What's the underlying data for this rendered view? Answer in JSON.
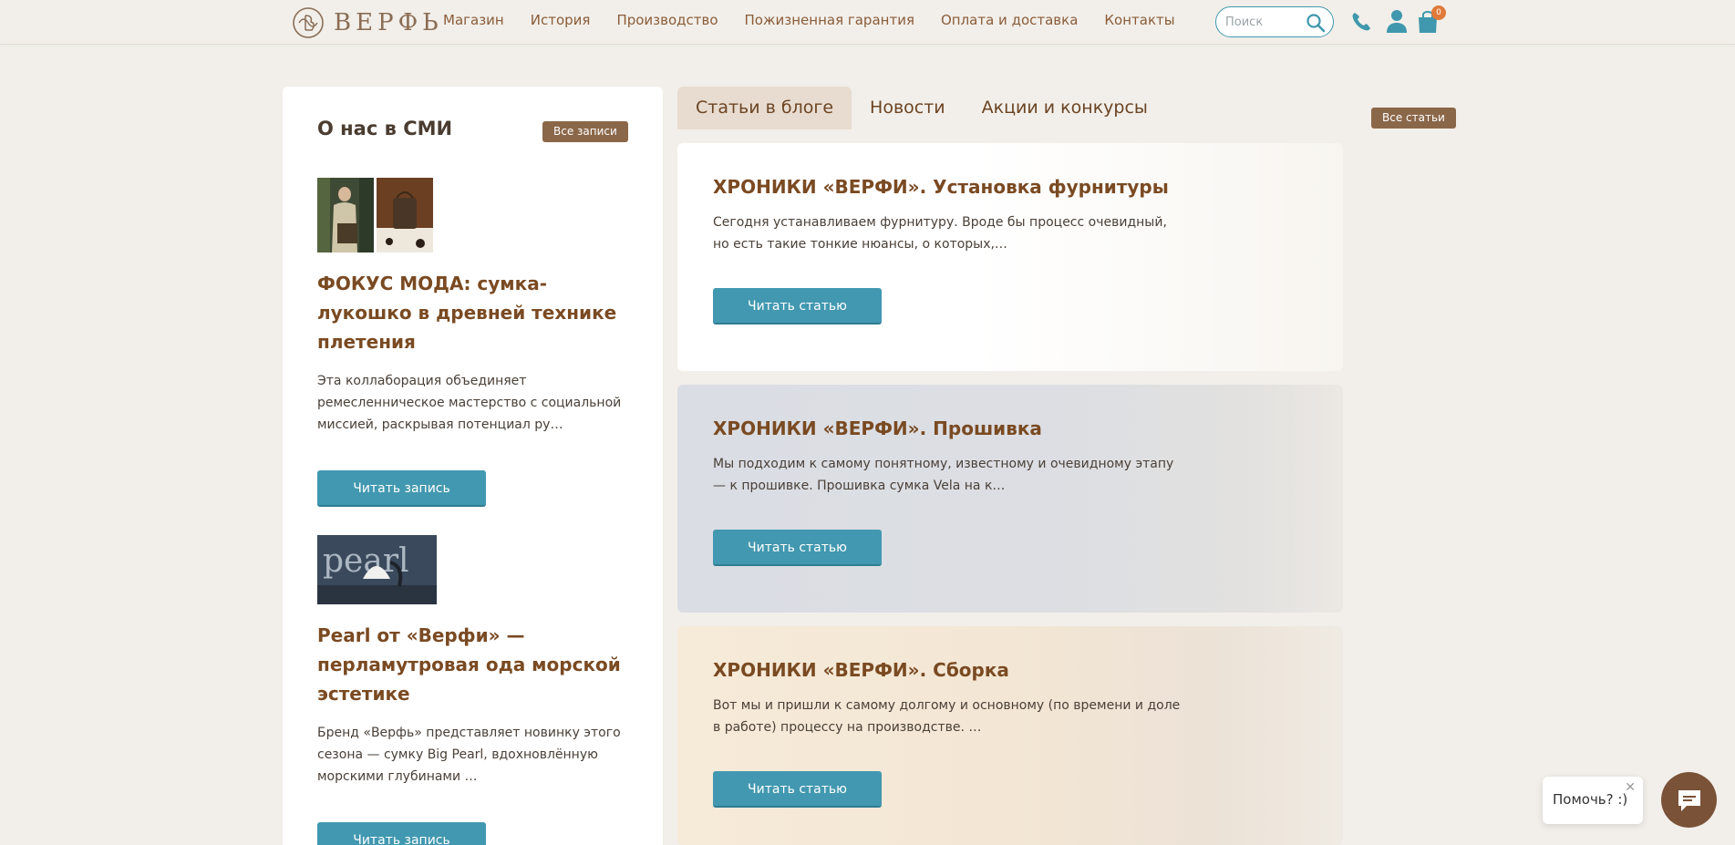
{
  "header": {
    "logo_text": "ВЕРФЬ",
    "nav": [
      "Магазин",
      "История",
      "Производство",
      "Пожизненная гарантия",
      "Оплата и доставка",
      "Контакты"
    ],
    "search_placeholder": "Поиск",
    "cart_count": "0"
  },
  "media": {
    "title": "О нас в СМИ",
    "all_label": "Все записи",
    "items": [
      {
        "title": "ФОКУС МОДА: сумка-лукошко в древней технике плетения",
        "text": "Эта коллаборация объединяет ремесленническое мастерство с социальной миссией, раскрывая потенциал ру…",
        "button": "Читать запись"
      },
      {
        "title": "Pearl от «Верфи» — перламутровая ода морской эстетике",
        "text": "Бренд «Верфь» представляет новинку этого сезона — сумку Big Pearl, вдохновлённую морскими глубинами …",
        "button": "Читать запись"
      }
    ]
  },
  "blog": {
    "tabs": [
      "Статьи в блоге",
      "Новости",
      "Акции и конкурсы"
    ],
    "all_label": "Все статьи",
    "articles": [
      {
        "title": "ХРОНИКИ «ВЕРФИ». Установка фурнитуры",
        "text": "Сегодня устанавливаем фурнитуру. Вроде бы процесс очевидный, но есть такие тонкие нюансы, о которых,…",
        "button": "Читать статью"
      },
      {
        "title": "ХРОНИКИ «ВЕРФИ». Прошивка",
        "text": "Мы подходим к самому понятному, известному и очевидному этапу — к прошивке. Прошивка сумка Vela на к…",
        "button": "Читать статью"
      },
      {
        "title": "ХРОНИКИ «ВЕРФИ». Сборка",
        "text": "Вот мы и пришли к самому долгому и основному (по времени и доле в работе) процессу на производстве. …",
        "button": "Читать статью"
      }
    ]
  },
  "widget": {
    "help_text": "Помочь? :)",
    "close": "✕"
  },
  "colors": {
    "accent": "#4298b0",
    "brand_brown": "#8b6749",
    "title_brown": "#7a4a22",
    "background": "#f2efea"
  }
}
